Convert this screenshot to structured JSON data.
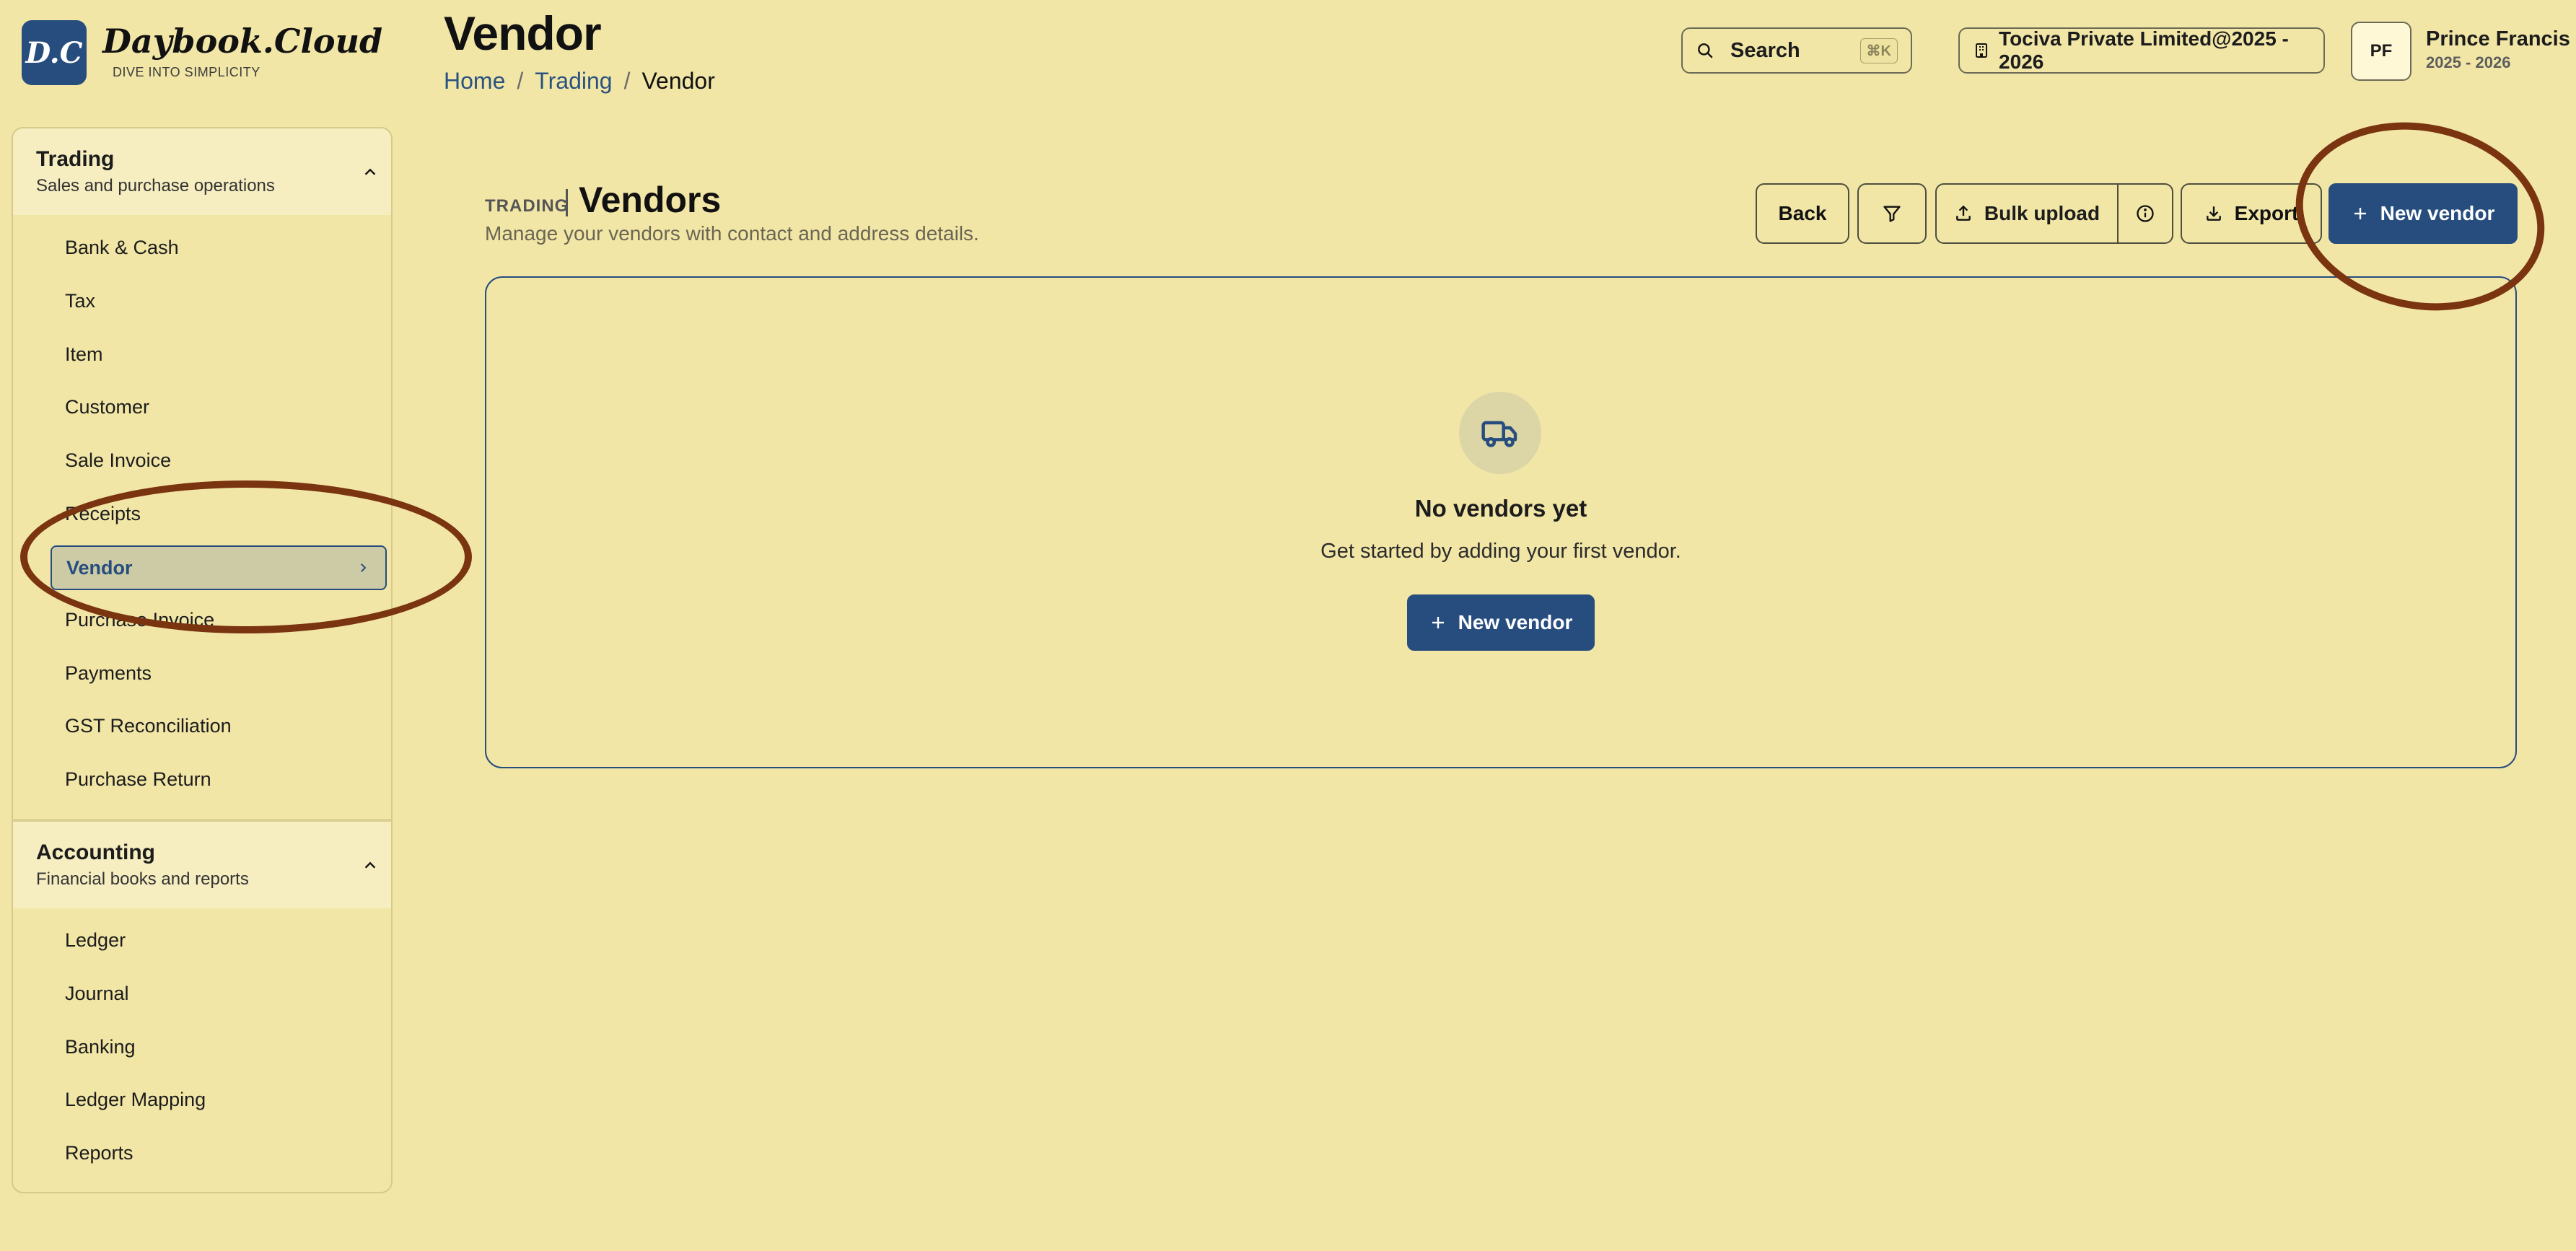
{
  "brand": {
    "mark": "D.C",
    "name": "Daybook.Cloud",
    "tagline": "DIVE INTO SIMPLICITY"
  },
  "header": {
    "title": "Vendor",
    "breadcrumb": [
      "Home",
      "Trading",
      "Vendor"
    ],
    "search_label": "Search",
    "search_shortcut": "⌘K",
    "org": "Tociva Private Limited@2025 - 2026",
    "user": {
      "initials": "PF",
      "name": "Prince Francis",
      "year": "2025 - 2026"
    }
  },
  "sidebar": {
    "sections": [
      {
        "title": "Trading",
        "subtitle": "Sales and purchase operations",
        "items": [
          "Bank & Cash",
          "Tax",
          "Item",
          "Customer",
          "Sale Invoice",
          "Receipts",
          "Vendor",
          "Purchase Invoice",
          "Payments",
          "GST Reconciliation",
          "Purchase Return"
        ],
        "active": "Vendor"
      },
      {
        "title": "Accounting",
        "subtitle": "Financial books and reports",
        "items": [
          "Ledger",
          "Journal",
          "Banking",
          "Ledger Mapping",
          "Reports"
        ]
      }
    ]
  },
  "main": {
    "section_label": "TRADING",
    "title": "Vendors",
    "description": "Manage your vendors with contact and address details.",
    "actions": {
      "back": "Back",
      "bulk_upload": "Bulk upload",
      "export": "Export",
      "new": "New vendor"
    },
    "empty": {
      "title": "No vendors yet",
      "description": "Get started by adding your first vendor.",
      "button": "New vendor"
    }
  },
  "colors": {
    "background": "#f2e6a7",
    "primary": "#264d7e",
    "annotation": "#7a3410"
  },
  "icons": [
    "search-icon",
    "building-icon",
    "chevron-up-icon",
    "chevron-right-icon",
    "filter-icon",
    "upload-icon",
    "info-icon",
    "download-icon",
    "plus-icon",
    "truck-icon"
  ]
}
